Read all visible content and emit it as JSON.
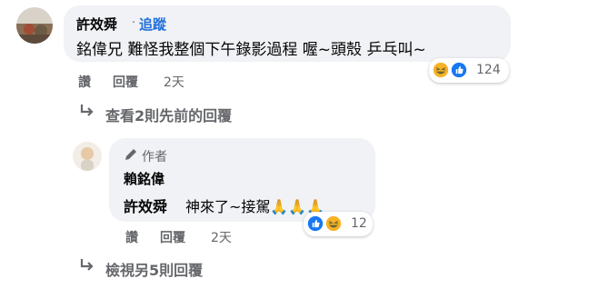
{
  "comment1": {
    "author": "許效舜",
    "follow_label": "追蹤",
    "text": "銘偉兄 難怪我整個下午錄影過程 喔~頭殼 乒乓叫~",
    "actions": {
      "like": "讚",
      "reply": "回覆",
      "time": "2天"
    },
    "reactions": {
      "types": [
        "haha",
        "like"
      ],
      "count": "124"
    }
  },
  "view_previous": "查看2則先前的回覆",
  "reply1": {
    "badge": "作者",
    "author": "賴銘偉",
    "mention": "許效舜",
    "text": "神來了~接駕🙏🙏🙏",
    "actions": {
      "like": "讚",
      "reply": "回覆",
      "time": "2天"
    },
    "reactions": {
      "types": [
        "like",
        "haha"
      ],
      "count": "12"
    }
  },
  "view_more": "檢視另5則回覆",
  "colors": {
    "link": "#216fdb",
    "bubble": "#f0f2f5",
    "secondary": "#65676b",
    "like": "#1877f2",
    "haha": "#f7b125"
  }
}
